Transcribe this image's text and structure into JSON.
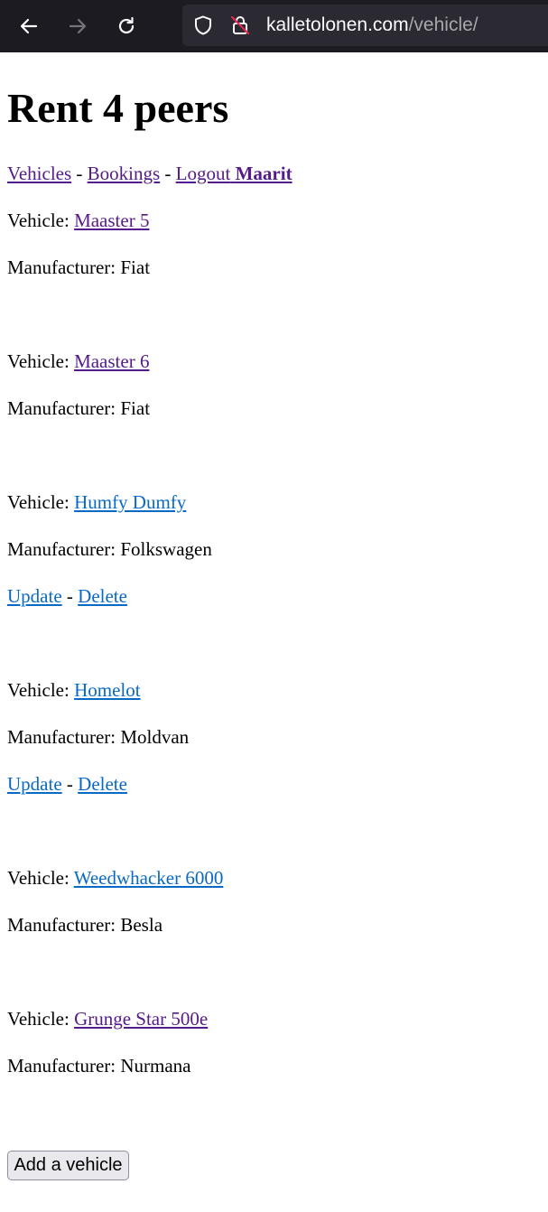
{
  "browser": {
    "url_domain": "kalletolonen.com",
    "url_path": "/vehicle/"
  },
  "page": {
    "title": "Rent 4 peers",
    "nav": {
      "vehicles": "Vehicles",
      "bookings": "Bookings",
      "logout": "Logout",
      "user": "Maarit",
      "separator": "-"
    },
    "vehicle_label": "Vehicle: ",
    "manufacturer_label": "Manufacturer: ",
    "update_label": "Update",
    "delete_label": "Delete",
    "action_separator": "-",
    "vehicles": [
      {
        "name": "Maaster 5",
        "manufacturer": "Fiat"
      },
      {
        "name": "Maaster 6",
        "manufacturer": "Fiat"
      },
      {
        "name": "Humfy Dumfy",
        "manufacturer": "Folkswagen"
      },
      {
        "name": "Homelot",
        "manufacturer": "Moldvan"
      },
      {
        "name": "Weedwhacker 6000",
        "manufacturer": "Besla"
      },
      {
        "name": "Grunge Star 500e",
        "manufacturer": "Nurmana"
      }
    ],
    "add_button": "Add a vehicle"
  }
}
